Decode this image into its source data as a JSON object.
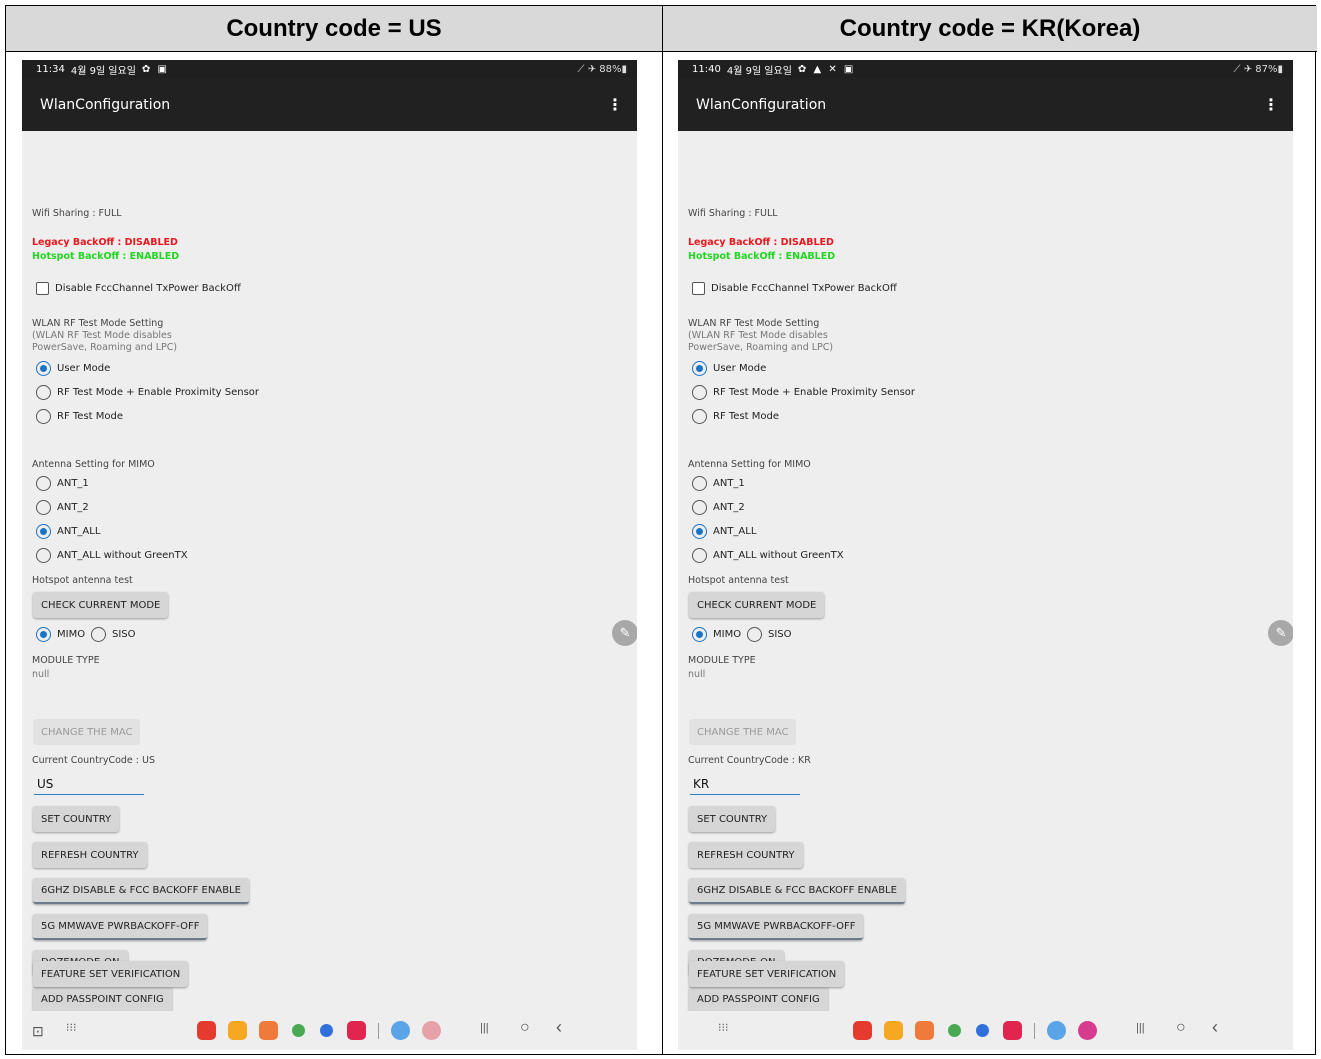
{
  "headers": {
    "left": "Country code = US",
    "right": "Country code = KR(Korea)"
  },
  "phones": [
    {
      "status": {
        "time": "11:34",
        "date": "4월 9일 일요일",
        "icons": "✿ ▣",
        "right": "⟋ ✈ 88%▮"
      },
      "app_title": "WlanConfiguration",
      "country_label": "Current CountryCode : US",
      "country_value": "US",
      "dock_extra_color": "#e6a2a8"
    },
    {
      "status": {
        "time": "11:40",
        "date": "4월 9일 일요일",
        "icons": "✿ ▲ ✕ ▣",
        "right": "⟋ ✈ 87%▮"
      },
      "app_title": "WlanConfiguration",
      "country_label": "Current CountryCode : KR",
      "country_value": "KR",
      "dock_extra_color": "#d63b8f"
    }
  ],
  "shared": {
    "wifi_sharing": "Wifi Sharing : FULL",
    "legacy_backoff": "Legacy BackOff : DISABLED",
    "hotspot_backoff": "Hotspot BackOff : ENABLED",
    "disable_fcc": "Disable FccChannel TxPower BackOff",
    "rf_title": "WLAN RF Test Mode Setting",
    "rf_note_1": "(WLAN RF Test Mode disables",
    "rf_note_2": " PowerSave, Roaming and LPC)",
    "rf_options": [
      "User Mode",
      "RF Test Mode + Enable Proximity Sensor",
      "RF Test Mode"
    ],
    "rf_selected": 0,
    "antenna_title": "Antenna Setting for MIMO",
    "antenna_options": [
      "ANT_1",
      "ANT_2",
      "ANT_ALL",
      "ANT_ALL without GreenTX"
    ],
    "antenna_selected": 2,
    "hotspot_title": "Hotspot antenna test",
    "check_mode_btn": "CHECK CURRENT MODE",
    "mimo": "MIMO",
    "siso": "SISO",
    "module_type_label": "MODULE TYPE",
    "module_type_value": "null",
    "change_mac_btn": "CHANGE THE MAC",
    "set_country_btn": "SET COUNTRY",
    "refresh_country_btn": "REFRESH COUNTRY",
    "sixghz_btn": "6GHZ DISABLE & FCC BACKOFF ENABLE",
    "mmwave_btn": "5G MMWAVE PWRBACKOFF-OFF",
    "doze_btn": "DOZEMODE-ON",
    "passpoint_btn": "ADD PASSPOINT CONFIG",
    "feature_btn": "FEATURE SET VERIFICATION",
    "menu_glyph": "⋮",
    "edit_glyph": "✎",
    "nav_recent": "|||",
    "nav_home": "○",
    "nav_back": "‹",
    "nav_apps": "⁝⁝⁝",
    "colors": {
      "accent": "#1a73c4",
      "legacy_red": "#e8181e",
      "hotspot_green": "#22d522"
    }
  }
}
